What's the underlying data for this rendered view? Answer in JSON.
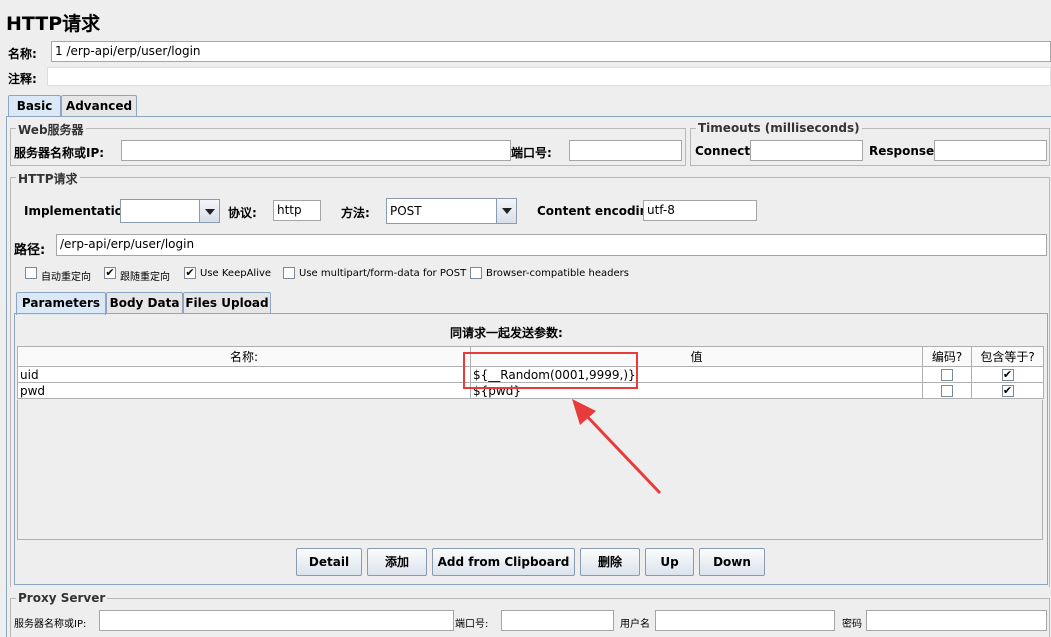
{
  "title": "HTTP请求",
  "name": {
    "label": "名称:",
    "value": "1 /erp-api/erp/user/login"
  },
  "comment": {
    "label": "注释:",
    "value": ""
  },
  "tabs": [
    {
      "label": "Basic",
      "active": true
    },
    {
      "label": "Advanced",
      "active": false
    }
  ],
  "web_server": {
    "title": "Web服务器",
    "server_label": "服务器名称或IP:",
    "server_value": "",
    "port_label": "端口号:",
    "port_value": ""
  },
  "timeouts": {
    "title": "Timeouts (milliseconds)",
    "connect_label": "Connect:",
    "connect_value": "",
    "response_label": "Response:",
    "response_value": ""
  },
  "http_request": {
    "title": "HTTP请求",
    "implementation_label": "Implementation:",
    "implementation_value": "",
    "protocol_label": "协议:",
    "protocol_value": "http",
    "method_label": "方法:",
    "method_value": "POST",
    "encoding_label": "Content encoding:",
    "encoding_value": "utf-8",
    "path_label": "路径:",
    "path_value": "/erp-api/erp/user/login"
  },
  "options": [
    {
      "label": "自动重定向",
      "checked": false
    },
    {
      "label": "跟随重定向",
      "checked": true
    },
    {
      "label": "Use KeepAlive",
      "checked": true
    },
    {
      "label": "Use multipart/form-data for POST",
      "checked": false
    },
    {
      "label": "Browser-compatible headers",
      "checked": false
    }
  ],
  "sub_tabs": [
    {
      "label": "Parameters"
    },
    {
      "label": "Body Data"
    },
    {
      "label": "Files Upload"
    }
  ],
  "params": {
    "caption": "同请求一起发送参数:",
    "columns": [
      "名称:",
      "值",
      "编码?",
      "包含等于?"
    ],
    "rows": [
      {
        "name": "uid",
        "value": "${__Random(0001,9999,)}",
        "encode": false,
        "include_equals": true
      },
      {
        "name": "pwd",
        "value": "${pwd}",
        "encode": false,
        "include_equals": true
      }
    ]
  },
  "buttons": [
    "Detail",
    "添加",
    "Add from Clipboard",
    "删除",
    "Up",
    "Down"
  ],
  "proxy": {
    "title": "Proxy Server",
    "server_label": "服务器名称或IP:",
    "port_label": "端口号:",
    "user_label": "用户名",
    "password_label": "密码"
  },
  "colors": {
    "highlight": "#e83c3c",
    "tab_active": "#dbe8f6"
  }
}
